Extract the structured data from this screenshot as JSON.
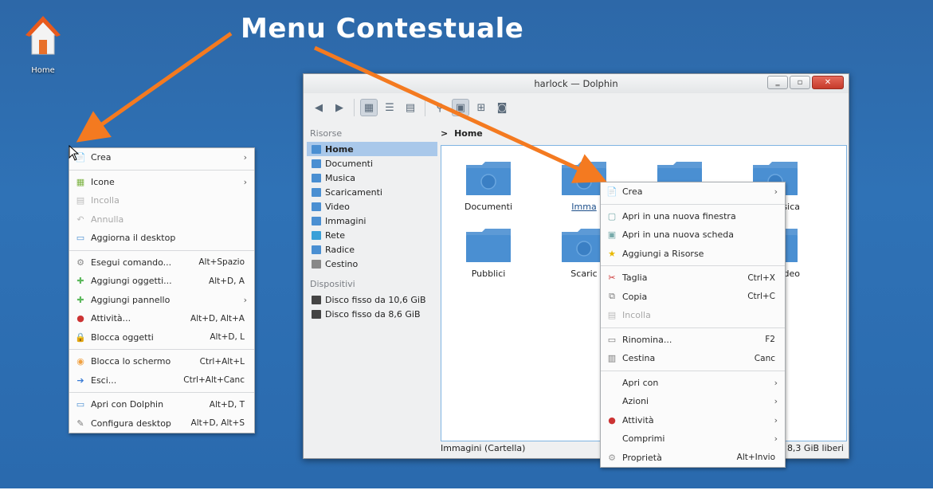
{
  "headline": "Menu Contestuale",
  "desktop": {
    "home_icon_label": "Home"
  },
  "desktop_menu": {
    "items": [
      {
        "label": "Crea",
        "shortcut": "",
        "submenu": true,
        "icon": "new-document-icon"
      },
      {
        "sep": true
      },
      {
        "label": "Icone",
        "shortcut": "",
        "submenu": true,
        "icon": "icons-view-icon"
      },
      {
        "label": "Incolla",
        "shortcut": "",
        "disabled": true,
        "icon": "paste-icon"
      },
      {
        "label": "Annulla",
        "shortcut": "",
        "disabled": true,
        "icon": "undo-icon"
      },
      {
        "label": "Aggiorna il desktop",
        "shortcut": "",
        "icon": "refresh-desktop-icon"
      },
      {
        "sep": true
      },
      {
        "label": "Esegui comando...",
        "shortcut": "Alt+Spazio",
        "icon": "run-command-icon"
      },
      {
        "label": "Aggiungi oggetti...",
        "shortcut": "Alt+D, A",
        "icon": "add-green-icon"
      },
      {
        "label": "Aggiungi pannello",
        "shortcut": "",
        "submenu": true,
        "icon": "add-green-icon"
      },
      {
        "label": "Attività...",
        "shortcut": "Alt+D, Alt+A",
        "icon": "activities-icon"
      },
      {
        "label": "Blocca oggetti",
        "shortcut": "Alt+D, L",
        "icon": "lock-icon"
      },
      {
        "sep": true
      },
      {
        "label": "Blocca lo schermo",
        "shortcut": "Ctrl+Alt+L",
        "icon": "lock-screen-icon"
      },
      {
        "label": "Esci...",
        "shortcut": "Ctrl+Alt+Canc",
        "icon": "logout-icon"
      },
      {
        "sep": true
      },
      {
        "label": "Apri con Dolphin",
        "shortcut": "Alt+D, T",
        "icon": "folder-open-icon"
      },
      {
        "label": "Configura desktop",
        "shortcut": "Alt+D, Alt+S",
        "icon": "configure-icon"
      }
    ]
  },
  "window": {
    "title": "harlock — Dolphin",
    "buttons": {
      "minimize": "‗",
      "maximize": "▫",
      "close": "✕"
    },
    "sidebar": {
      "sections": [
        {
          "title": "Risorse",
          "items": [
            {
              "label": "Home",
              "active": true
            },
            {
              "label": "Documenti"
            },
            {
              "label": "Musica"
            },
            {
              "label": "Scaricamenti"
            },
            {
              "label": "Video"
            },
            {
              "label": "Immagini"
            },
            {
              "label": "Rete"
            },
            {
              "label": "Radice"
            },
            {
              "label": "Cestino"
            }
          ]
        },
        {
          "title": "Dispositivi",
          "items": [
            {
              "label": "Disco fisso da 10,6 GiB"
            },
            {
              "label": "Disco fisso da 8,6 GiB"
            }
          ]
        }
      ]
    },
    "breadcrumb": {
      "separator": ">",
      "current": "Home"
    },
    "folders": [
      {
        "label": "Documenti",
        "emblem": "document"
      },
      {
        "label": "Immagini",
        "emblem": "image",
        "selected": true
      },
      {
        "label": "",
        "emblem": "none"
      },
      {
        "label": "Musica",
        "emblem": "music"
      },
      {
        "label": "Pubblici",
        "emblem": "none"
      },
      {
        "label": "Scaricamenti",
        "emblem": "download"
      },
      {
        "label": "",
        "emblem": "none"
      },
      {
        "label": "Video",
        "emblem": "video"
      }
    ],
    "folder_visible_labels": [
      "Documenti",
      "Imma",
      "",
      "isica",
      "Pubblici",
      "Scaric",
      "",
      "deo"
    ],
    "status": {
      "left": "Immagini (Cartella)",
      "right": "8,3 GiB liberi"
    }
  },
  "file_menu": {
    "items": [
      {
        "label": "Crea",
        "shortcut": "",
        "submenu": true,
        "icon": "new-document-icon"
      },
      {
        "sep": true
      },
      {
        "label": "Apri in una nuova finestra",
        "shortcut": "",
        "icon": "new-window-icon"
      },
      {
        "label": "Apri in una nuova scheda",
        "shortcut": "",
        "icon": "new-tab-icon"
      },
      {
        "label": "Aggiungi a Risorse",
        "shortcut": "",
        "icon": "bookmark-star-icon"
      },
      {
        "sep": true
      },
      {
        "label": "Taglia",
        "shortcut": "Ctrl+X",
        "icon": "cut-icon"
      },
      {
        "label": "Copia",
        "shortcut": "Ctrl+C",
        "icon": "copy-icon"
      },
      {
        "label": "Incolla",
        "shortcut": "",
        "disabled": true,
        "icon": "paste-icon"
      },
      {
        "sep": true
      },
      {
        "label": "Rinomina...",
        "shortcut": "F2",
        "icon": "rename-icon"
      },
      {
        "label": "Cestina",
        "shortcut": "Canc",
        "icon": "trash-icon"
      },
      {
        "sep": true
      },
      {
        "label": "Apri con",
        "shortcut": "",
        "submenu": true,
        "icon": ""
      },
      {
        "label": "Azioni",
        "shortcut": "",
        "submenu": true,
        "icon": ""
      },
      {
        "label": "Attività",
        "shortcut": "",
        "submenu": true,
        "icon": "activities-icon"
      },
      {
        "label": "Comprimi",
        "shortcut": "",
        "submenu": true,
        "icon": ""
      },
      {
        "label": "Proprietà",
        "shortcut": "Alt+Invio",
        "icon": "properties-icon"
      }
    ]
  },
  "colors": {
    "desktop": "#2f6fb3",
    "arrow": "#f47a20",
    "folder": "#4a8fd2",
    "selection": "#a9c8ea"
  }
}
